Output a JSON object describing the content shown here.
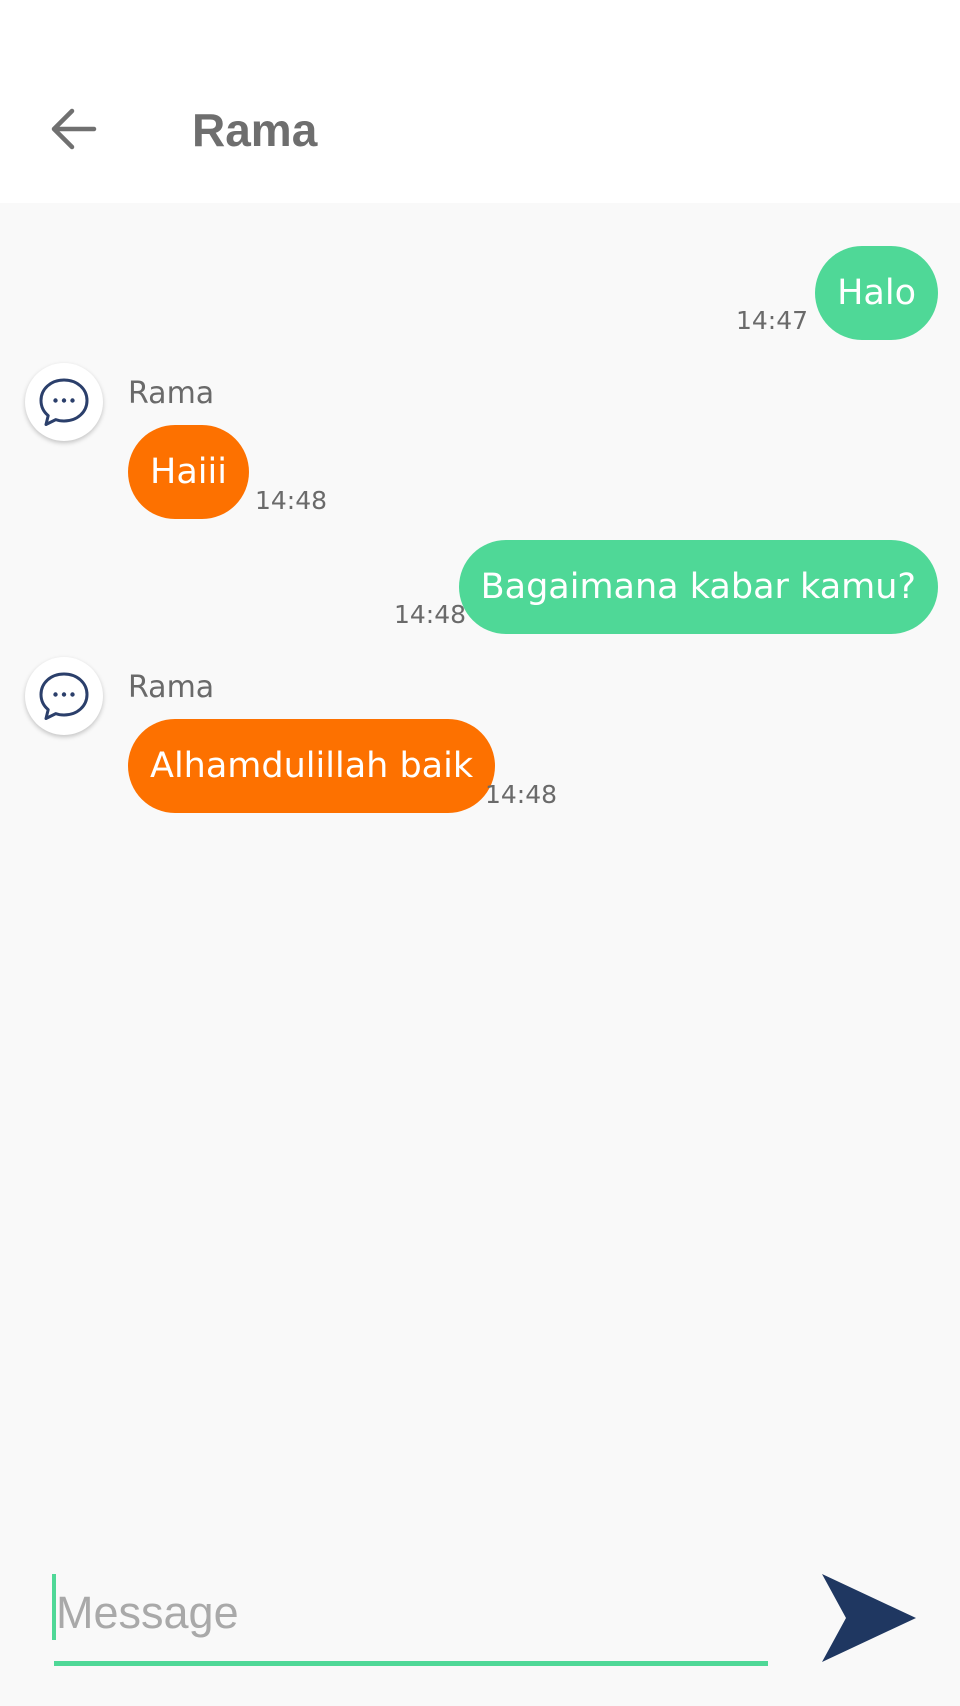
{
  "header": {
    "title": "Rama",
    "back_icon": "arrow-left-icon"
  },
  "messages": [
    {
      "direction": "out",
      "text": "Halo",
      "time": "14:47"
    },
    {
      "direction": "in",
      "sender": "Rama",
      "text": "Haiii",
      "time": "14:48"
    },
    {
      "direction": "out",
      "text": "Bagaimana kabar kamu?",
      "time": "14:48"
    },
    {
      "direction": "in",
      "sender": "Rama",
      "text": "Alhamdulillah baik",
      "time": "14:48"
    }
  ],
  "composer": {
    "placeholder": "Message",
    "value": "",
    "send_icon": "send-icon"
  },
  "colors": {
    "outgoing_bubble": "#4fd897",
    "incoming_bubble": "#fd7100",
    "accent": "#4fd897",
    "send_icon": "#1f3761",
    "avatar_icon": "#2b3f6b"
  }
}
